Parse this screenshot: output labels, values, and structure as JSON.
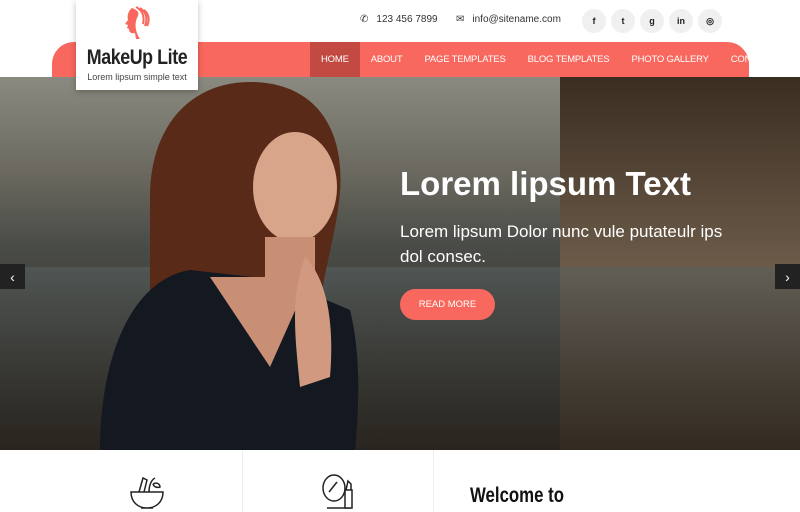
{
  "logo": {
    "title": "MakeUp Lite",
    "tagline": "Lorem lipsum simple text"
  },
  "contact": {
    "phone": "123 456 7899",
    "email": "info@sitename.com"
  },
  "social": [
    {
      "icon": "facebook-icon",
      "glyph": "f"
    },
    {
      "icon": "twitter-icon",
      "glyph": "t"
    },
    {
      "icon": "google-plus-icon",
      "glyph": "g"
    },
    {
      "icon": "linkedin-icon",
      "glyph": "in"
    },
    {
      "icon": "instagram-icon",
      "glyph": "◎"
    }
  ],
  "nav": [
    "HOME",
    "ABOUT",
    "PAGE TEMPLATES",
    "BLOG TEMPLATES",
    "PHOTO GALLERY",
    "CONTACT"
  ],
  "hero": {
    "title": "Lorem lipsum Text",
    "text": "Lorem lipsum Dolor nunc vule putateulr ips dol consec.",
    "button": "READ MORE"
  },
  "welcome": "Welcome to",
  "colors": {
    "accent": "#f8685e",
    "active": "#c24a42"
  }
}
